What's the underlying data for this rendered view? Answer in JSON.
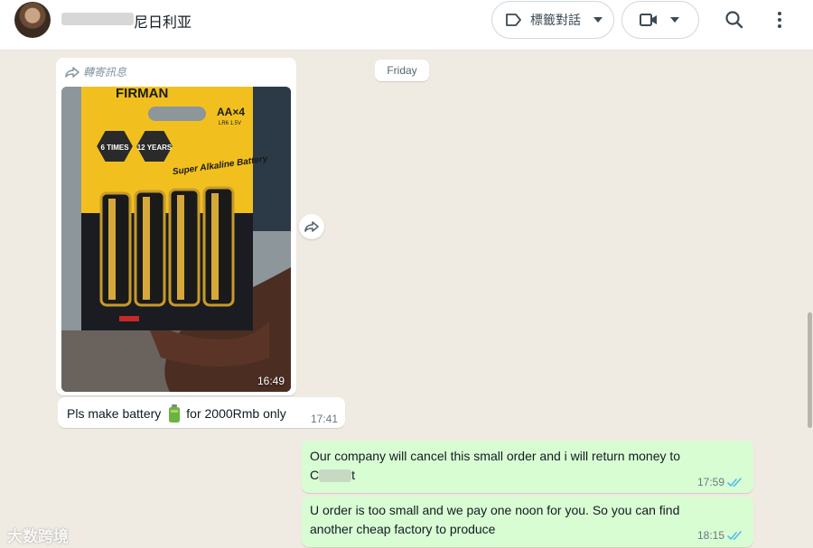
{
  "header": {
    "contact_name": "尼日利亚",
    "label_button": "標籤對話"
  },
  "chat": {
    "date_divider": "Friday",
    "messages": [
      {
        "direction": "incoming",
        "forwarded_label": "轉寄訊息",
        "type": "image",
        "time": "16:49",
        "product_text": {
          "brand": "FIRMAN",
          "size": "AA×4",
          "spec": "LR6 1.5V",
          "badge1": "6 TIMES",
          "badge2": "12 YEARS",
          "headline": "Super Alkaline Battery"
        }
      },
      {
        "direction": "incoming",
        "type": "text",
        "text_before": "Pls make battery",
        "emoji": "🔋",
        "text_after": "for 2000Rmb only",
        "time": "17:41"
      },
      {
        "direction": "outgoing",
        "type": "text",
        "text_line1": "Our company will cancel this small order and i will return money to",
        "text_line2_prefix": "C",
        "text_line2_suffix": "t",
        "time": "17:59"
      },
      {
        "direction": "outgoing",
        "type": "text",
        "text_line1": "U order is too small and we pay one noon for you. So you can find",
        "text_line2": "another cheap factory to produce",
        "time": "18:15"
      }
    ]
  },
  "watermark": "大数跨境",
  "colors": {
    "outgoing_bubble": "#d9fdd3",
    "incoming_bubble": "#ffffff",
    "chat_background": "#efeae2",
    "read_ticks": "#53bdeb"
  }
}
